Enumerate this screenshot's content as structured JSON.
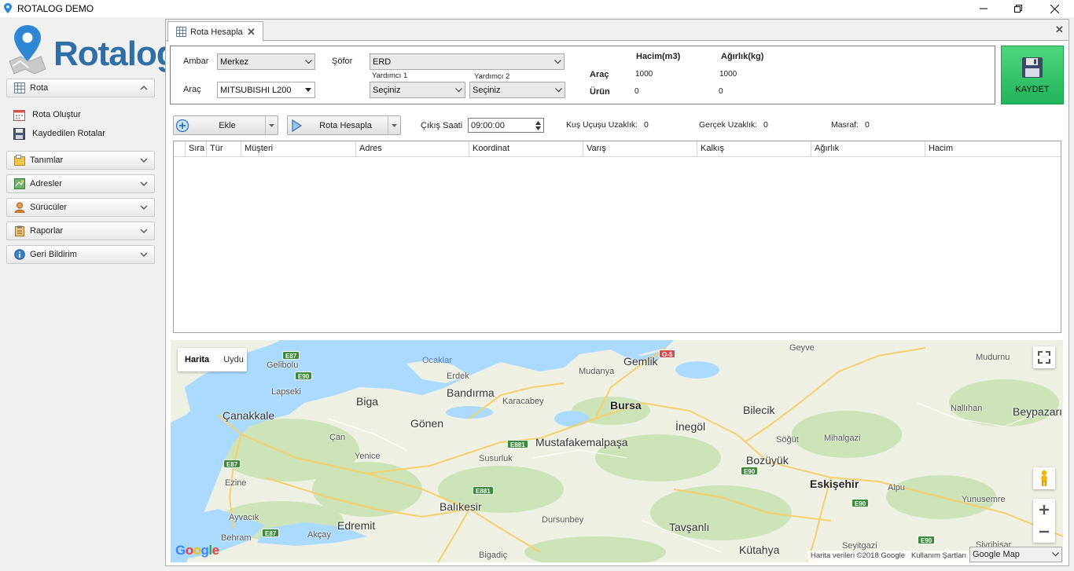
{
  "window": {
    "title": "ROTALOG DEMO",
    "minimize": "—",
    "maximize": "❐",
    "close": "✕"
  },
  "sidebar": {
    "logo_text": "Rotalog",
    "groups": [
      {
        "label": "Rota",
        "icon": "route-grid-icon",
        "expanded": true
      },
      {
        "label": "Tanımlar",
        "icon": "folder-icon",
        "expanded": false
      },
      {
        "label": "Adresler",
        "icon": "map-icon",
        "expanded": false
      },
      {
        "label": "Sürücüler",
        "icon": "driver-icon",
        "expanded": false
      },
      {
        "label": "Raporlar",
        "icon": "report-icon",
        "expanded": false
      },
      {
        "label": "Geri Bildirim",
        "icon": "info-icon",
        "expanded": false
      }
    ],
    "rota_items": [
      {
        "label": "Rota Oluştur",
        "icon": "calendar-icon"
      },
      {
        "label": "Kaydedilen Rotalar",
        "icon": "save-icon"
      }
    ]
  },
  "tab": {
    "label": "Rota Hesapla",
    "close": "✕"
  },
  "form": {
    "ambar_label": "Ambar",
    "ambar_value": "Merkez",
    "arac_label": "Araç",
    "arac_value": "MITSUBISHI L200",
    "sofor_label": "Şöfor",
    "sofor_value": "ERD",
    "yardimci1_label": "Yardımcı 1",
    "yardimci1_value": "Seçiniz",
    "yardimci2_label": "Yardımcı 2",
    "yardimci2_value": "Seçiniz",
    "summary": {
      "hacim_header": "Hacim(m3)",
      "agirlik_header": "Ağırlık(kg)",
      "arac_row_label": "Araç",
      "arac_hacim": "1000",
      "arac_agirlik": "1000",
      "urun_row_label": "Ürün",
      "urun_hacim": "0",
      "urun_agirlik": "0"
    },
    "save_label": "KAYDET"
  },
  "toolbar": {
    "ekle_label": "Ekle",
    "rota_hesapla_label": "Rota Hesapla",
    "cikis_saati_label": "Çıkış Saati",
    "cikis_saati_value": "09:00:00",
    "kus_ucusu_label": "Kuş Uçuşu Uzaklık:",
    "kus_ucusu_value": "0",
    "gercek_label": "Gerçek Uzaklık:",
    "gercek_value": "0",
    "masraf_label": "Masraf:",
    "masraf_value": "0"
  },
  "grid": {
    "columns": [
      "",
      "Sıra",
      "Tür",
      "Müşteri",
      "Adres",
      "Koordinat",
      "Varış",
      "Kalkış",
      "Ağırlık",
      "Hacim"
    ]
  },
  "map": {
    "type_buttons": [
      "Harita",
      "Uydu"
    ],
    "places": [
      {
        "name": "Gelibolu",
        "kind": "town"
      },
      {
        "name": "Lapseki",
        "kind": "town"
      },
      {
        "name": "Çanakkale",
        "kind": "city"
      },
      {
        "name": "Biga",
        "kind": "city"
      },
      {
        "name": "Çan",
        "kind": "town"
      },
      {
        "name": "Yenice",
        "kind": "town"
      },
      {
        "name": "Ezine",
        "kind": "town"
      },
      {
        "name": "Ayvacık",
        "kind": "town"
      },
      {
        "name": "Behram",
        "kind": "town"
      },
      {
        "name": "Edremit",
        "kind": "city"
      },
      {
        "name": "Akçay",
        "kind": "town"
      },
      {
        "name": "Ocaklar",
        "kind": "town"
      },
      {
        "name": "Erdek",
        "kind": "town"
      },
      {
        "name": "Bandırma",
        "kind": "city"
      },
      {
        "name": "Gönen",
        "kind": "city"
      },
      {
        "name": "Mudanya",
        "kind": "town"
      },
      {
        "name": "Gemlik",
        "kind": "city"
      },
      {
        "name": "Karacabey",
        "kind": "town"
      },
      {
        "name": "Bursa",
        "kind": "major"
      },
      {
        "name": "Mustafakemalpaşa",
        "kind": "city"
      },
      {
        "name": "Susurluk",
        "kind": "town"
      },
      {
        "name": "Balıkesir",
        "kind": "city"
      },
      {
        "name": "Dursunbey",
        "kind": "town"
      },
      {
        "name": "Bigadiç",
        "kind": "town"
      },
      {
        "name": "İnegöl",
        "kind": "city"
      },
      {
        "name": "Bilecik",
        "kind": "city"
      },
      {
        "name": "Söğüt",
        "kind": "town"
      },
      {
        "name": "Bozüyük",
        "kind": "city"
      },
      {
        "name": "Tavşanlı",
        "kind": "town"
      },
      {
        "name": "Kütahya",
        "kind": "city"
      },
      {
        "name": "Eskişehir",
        "kind": "major"
      },
      {
        "name": "Seyitgazi",
        "kind": "town"
      },
      {
        "name": "Sivrihisar",
        "kind": "town"
      },
      {
        "name": "Geyve",
        "kind": "town"
      },
      {
        "name": "Mudurnu",
        "kind": "town"
      },
      {
        "name": "Nallıhan",
        "kind": "town"
      },
      {
        "name": "Beypazarı",
        "kind": "city"
      },
      {
        "name": "Mihalgazi",
        "kind": "town"
      },
      {
        "name": "Alpu",
        "kind": "town"
      },
      {
        "name": "Yunusemre",
        "kind": "town"
      }
    ],
    "road_shields": [
      "E87",
      "E90",
      "E87",
      "E87",
      "E881",
      "E881",
      "E90",
      "E90",
      "E90",
      "O-5"
    ],
    "attribution": "Harita verileri ©2018 Google",
    "terms": "Kullanım Şartları",
    "provider_select": "Google Map",
    "google_logo": "Google"
  }
}
